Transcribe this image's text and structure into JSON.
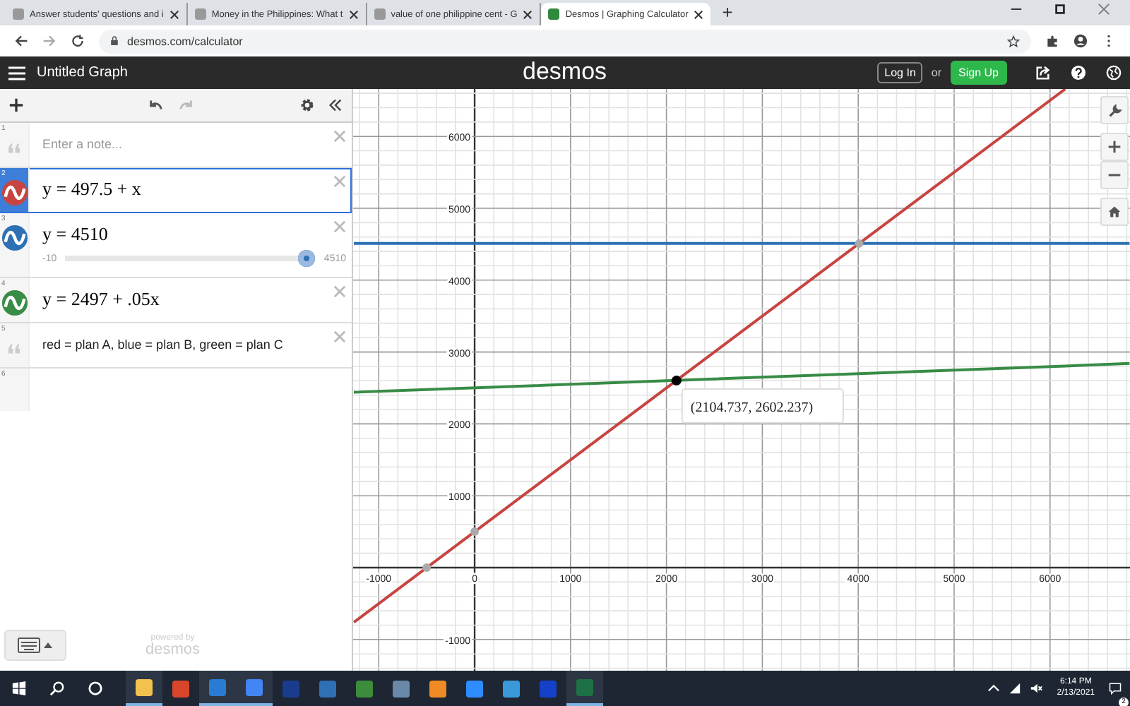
{
  "browser": {
    "tabs": [
      {
        "title": "Answer students' questions and i",
        "selected": false
      },
      {
        "title": "Money in the Philippines: What t",
        "selected": false
      },
      {
        "title": "value of one philippine cent - G",
        "selected": false
      },
      {
        "title": "Desmos | Graphing Calculator",
        "selected": true
      }
    ],
    "new_tab": "+",
    "url": "desmos.com/calculator"
  },
  "header": {
    "title": "Untitled Graph",
    "logo": "desmos",
    "login": "Log In",
    "or": "or",
    "signup": "Sign Up"
  },
  "expressions": [
    {
      "kind": "note",
      "number": "1",
      "placeholder": "Enter a note...",
      "selected": false
    },
    {
      "kind": "expression",
      "number": "2",
      "latex": "y = 497.5 + x",
      "color": "#c74440",
      "selected": true
    },
    {
      "kind": "slider",
      "number": "3",
      "latex": "y = 4510",
      "color": "#2d70b3",
      "selected": false,
      "min": "-10",
      "max": "4510",
      "level": 1
    },
    {
      "kind": "expression",
      "number": "4",
      "latex": "y = 2497 + .05x",
      "color": "#388c46",
      "selected": false
    },
    {
      "kind": "note",
      "number": "5",
      "text": "red = plan A, blue = plan B, green = plan C",
      "selected": false
    },
    {
      "kind": "empty",
      "number": "6",
      "selected": false
    }
  ],
  "powered_by": {
    "line1": "powered by",
    "line2": "desmos"
  },
  "graph": {
    "chart_data": {
      "type": "line",
      "x": [
        -1260,
        6160,
        6830
      ],
      "xlim": [
        -1267,
        6834
      ],
      "ylim": [
        -1434,
        6660
      ],
      "grid": true,
      "series": [
        {
          "color": "#c74440",
          "values": [
            -760,
            6660,
            null
          ]
        },
        {
          "color": "#2d70b3",
          "values": [
            4510,
            4510,
            4510
          ]
        },
        {
          "color": "#388c46",
          "values": [
            2440,
            2805,
            2840
          ]
        }
      ],
      "xticks": [
        -1000,
        0,
        1000,
        2000,
        3000,
        4000,
        5000,
        6000
      ],
      "yticks": [
        -1000,
        1000,
        2000,
        3000,
        4000,
        5000,
        6000
      ],
      "annotations": [
        {
          "x": 2104.737,
          "y": 2602.237,
          "text": "(2104.737, 2602.237)"
        }
      ]
    }
  },
  "taskbar": {
    "apps": [
      {
        "running": true
      },
      {
        "running": false
      },
      {
        "running": true
      },
      {
        "running": true
      },
      {
        "running": false
      },
      {
        "running": false
      },
      {
        "running": false
      },
      {
        "running": false
      },
      {
        "running": false
      },
      {
        "running": false
      },
      {
        "running": false
      },
      {
        "running": false
      },
      {
        "running": true
      }
    ],
    "time": "6:14 PM",
    "date": "2/13/2021",
    "notifications": "2"
  }
}
